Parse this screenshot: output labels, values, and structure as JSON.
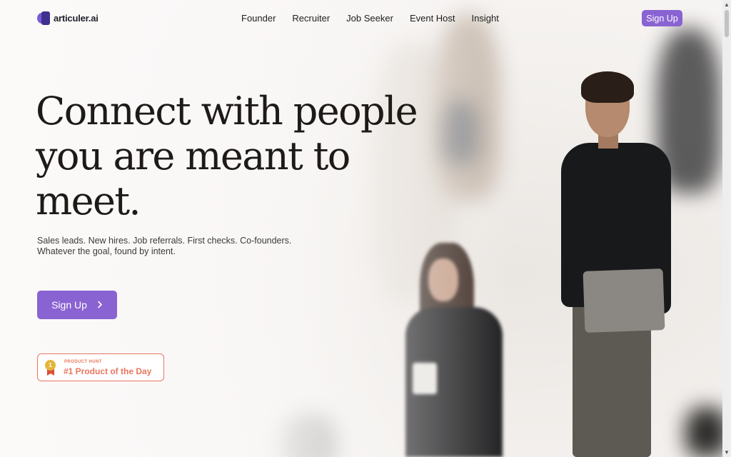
{
  "brand": {
    "name": "articuler.ai"
  },
  "nav": {
    "links": [
      "Founder",
      "Recruiter",
      "Job Seeker",
      "Event Host",
      "Insight"
    ],
    "signup_label": "Sign Up"
  },
  "hero": {
    "headline_lines": [
      "Connect with people",
      "you are meant to",
      "meet."
    ],
    "subtitle_lines": [
      "Sales leads. New hires. Job referrals. First checks. Co-founders.",
      "Whatever the goal, found by intent."
    ],
    "cta_label": "Sign Up",
    "cta_icon": "chevron-right-icon"
  },
  "badge": {
    "kicker": "PRODUCT HUNT",
    "title": "#1 Product of the Day",
    "medal_number": "1",
    "accent_color": "#e8765e"
  },
  "colors": {
    "accent": "#8a63d2",
    "text": "#1e1a18"
  }
}
